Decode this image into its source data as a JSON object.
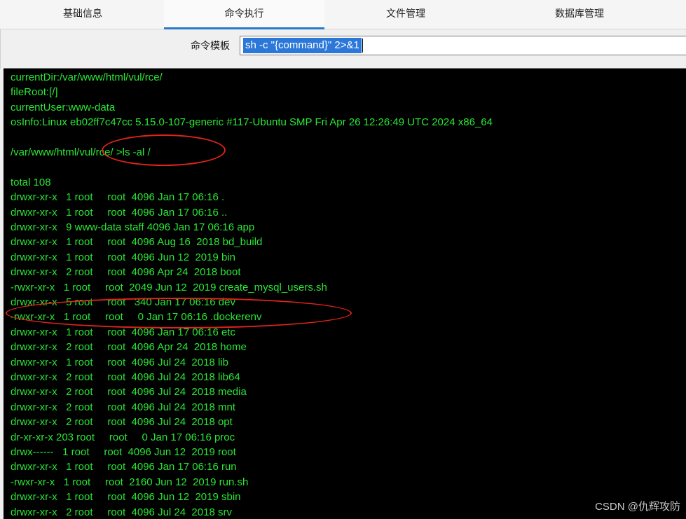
{
  "tabs": [
    {
      "label": "基础信息",
      "active": false
    },
    {
      "label": "命令执行",
      "active": true
    },
    {
      "label": "文件管理",
      "active": false
    },
    {
      "label": "数据库管理",
      "active": false
    }
  ],
  "command_template": {
    "label": "命令模板",
    "value": "sh -c \"{command}\" 2>&1"
  },
  "console": {
    "lines": [
      "currentDir:/var/www/html/vul/rce/",
      "fileRoot:[/]",
      "currentUser:www-data",
      "osInfo:Linux eb02ff7c47cc 5.15.0-107-generic #117-Ubuntu SMP Fri Apr 26 12:26:49 UTC 2024 x86_64",
      "",
      "/var/www/html/vul/rce/ >ls -al /",
      "",
      "total 108",
      "drwxr-xr-x   1 root     root  4096 Jan 17 06:16 .",
      "drwxr-xr-x   1 root     root  4096 Jan 17 06:16 ..",
      "drwxr-xr-x   9 www-data staff 4096 Jan 17 06:16 app",
      "drwxr-xr-x   1 root     root  4096 Aug 16  2018 bd_build",
      "drwxr-xr-x   1 root     root  4096 Jun 12  2019 bin",
      "drwxr-xr-x   2 root     root  4096 Apr 24  2018 boot",
      "-rwxr-xr-x   1 root     root  2049 Jun 12  2019 create_mysql_users.sh",
      "drwxr-xr-x   5 root     root   340 Jan 17 06:16 dev",
      "-rwxr-xr-x   1 root     root     0 Jan 17 06:16 .dockerenv",
      "drwxr-xr-x   1 root     root  4096 Jan 17 06:16 etc",
      "drwxr-xr-x   2 root     root  4096 Apr 24  2018 home",
      "drwxr-xr-x   1 root     root  4096 Jul 24  2018 lib",
      "drwxr-xr-x   2 root     root  4096 Jul 24  2018 lib64",
      "drwxr-xr-x   2 root     root  4096 Jul 24  2018 media",
      "drwxr-xr-x   2 root     root  4096 Jul 24  2018 mnt",
      "drwxr-xr-x   2 root     root  4096 Jul 24  2018 opt",
      "dr-xr-xr-x 203 root     root     0 Jan 17 06:16 proc",
      "drwx------   1 root     root  4096 Jun 12  2019 root",
      "drwxr-xr-x   1 root     root  4096 Jan 17 06:16 run",
      "-rwxr-xr-x   1 root     root  2160 Jun 12  2019 run.sh",
      "drwxr-xr-x   1 root     root  4096 Jun 12  2019 sbin",
      "drwxr-xr-x   2 root     root  4096 Jul 24  2018 srv"
    ]
  },
  "watermark": "CSDN @仇辉攻防",
  "colors": {
    "console_text": "#29e634",
    "console_bg": "#000000",
    "active_tab_accent": "#2a78c8",
    "annotation": "#e0241c"
  }
}
